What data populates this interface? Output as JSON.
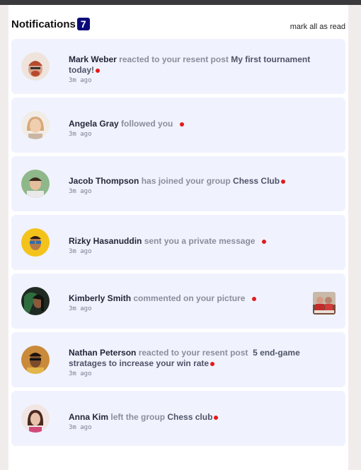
{
  "header": {
    "title": "Notifications",
    "unread_count": "7",
    "mark_all_label": "mark all as read"
  },
  "notifications": [
    {
      "actor": "Mark Weber",
      "action": "reacted to your resent post",
      "target": "My first tournament today!",
      "time": "3m ago",
      "unread": true,
      "avatar_color": "#d9a38a"
    },
    {
      "actor": "Angela Gray",
      "action": "followed you",
      "target": "",
      "time": "3m ago",
      "unread": true,
      "avatar_color": "#e9c9a8"
    },
    {
      "actor": "Jacob Thompson",
      "action": "has joined your group",
      "target": "Chess Club",
      "time": "3m ago",
      "unread": true,
      "avatar_color": "#7fae79"
    },
    {
      "actor": "Rizky Hasanuddin",
      "action": "sent you a private message",
      "target": "",
      "time": "3m ago",
      "unread": true,
      "avatar_color": "#f3c31b"
    },
    {
      "actor": "Kimberly Smith",
      "action": "commented on your picture",
      "target": "",
      "time": "3m ago",
      "unread": true,
      "avatar_color": "#2f5e3c"
    },
    {
      "actor": "Nathan Peterson",
      "action": "reacted to your resent post",
      "target": "5 end-game stratages to increase your win rate",
      "time": "3m ago",
      "unread": true,
      "avatar_color": "#9a6a3a"
    },
    {
      "actor": "Anna Kim",
      "action": "left the group",
      "target": "Chess club",
      "time": "3m ago",
      "unread": true,
      "avatar_color": "#e8cfc9"
    }
  ]
}
